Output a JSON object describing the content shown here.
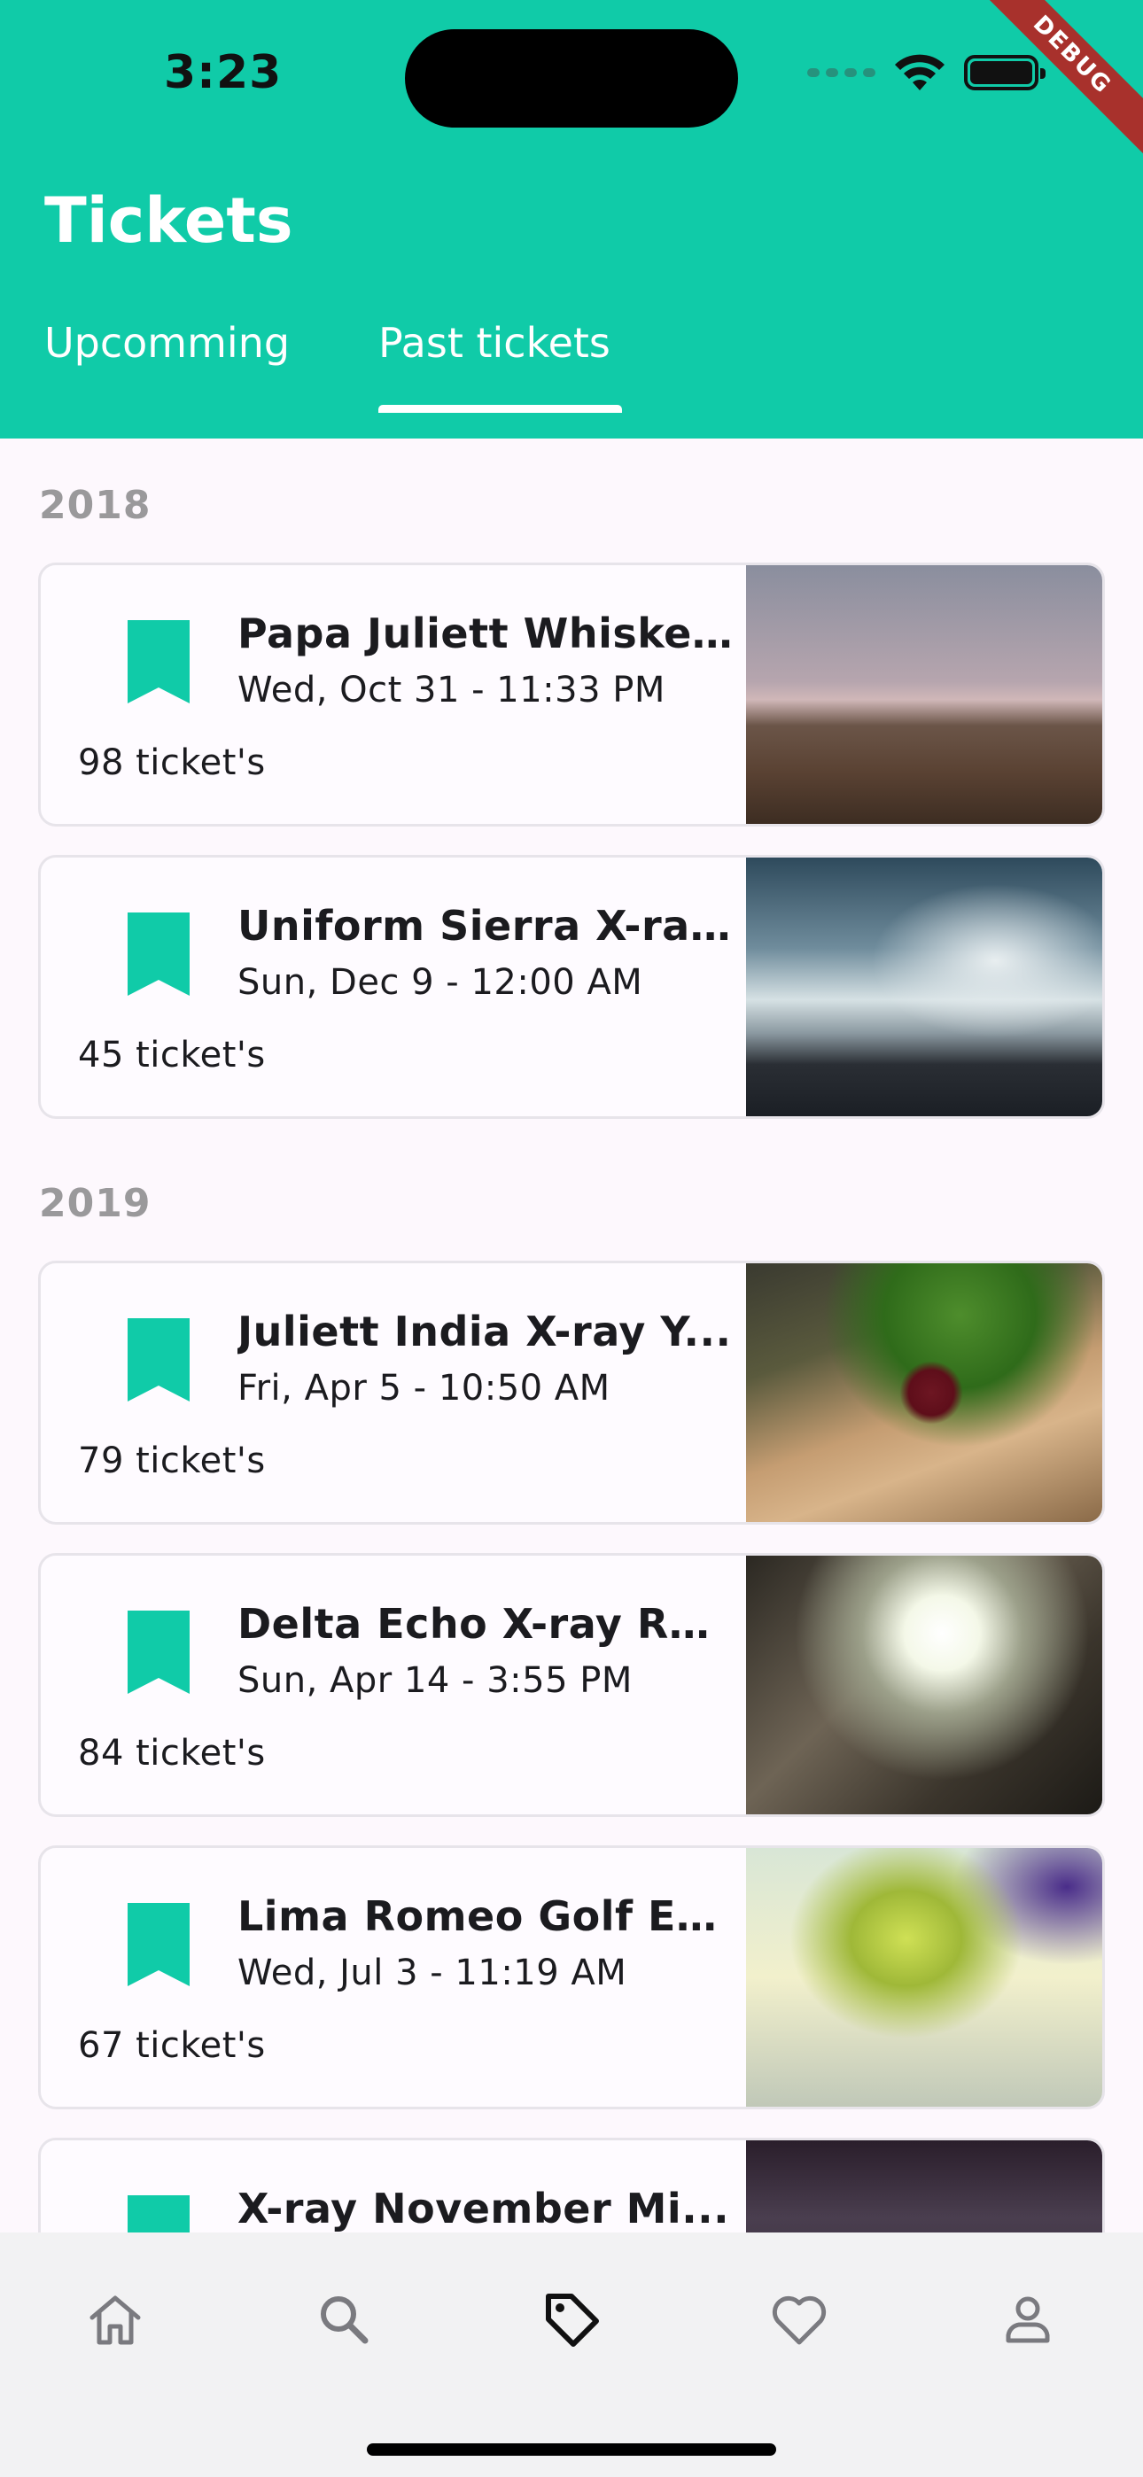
{
  "status_bar": {
    "time": "3:23"
  },
  "debug_banner": "DEBUG",
  "header": {
    "title": "Tickets",
    "tabs": [
      {
        "label": "Upcomming",
        "selected": false
      },
      {
        "label": "Past tickets",
        "selected": true
      }
    ]
  },
  "sections": [
    {
      "year": "2018",
      "tickets": [
        {
          "title": "Papa Juliett Whiske...",
          "date": "Wed, Oct 31 - 11:33 PM",
          "count": "98 ticket's",
          "image": "foggy field landscape"
        },
        {
          "title": "Uniform Sierra X-ra...",
          "date": "Sun, Dec 9 - 12:00 AM",
          "count": "45 ticket's",
          "image": "ocean waves on rocks"
        }
      ]
    },
    {
      "year": "2019",
      "tickets": [
        {
          "title": "Juliett India X-ray Y...",
          "date": "Fri, Apr 5 - 10:50 AM",
          "count": "79 ticket's",
          "image": "red onion and vegetables"
        },
        {
          "title": "Delta Echo X-ray Ro...",
          "date": "Sun, Apr 14 - 3:55 PM",
          "count": "84 ticket's",
          "image": "looking up between buildings"
        },
        {
          "title": "Lima Romeo Golf Ec...",
          "date": "Wed, Jul 3 - 11:19 AM",
          "count": "67 ticket's",
          "image": "green leaf close-up"
        },
        {
          "title": "X-ray November Mi...",
          "date": "",
          "count": "",
          "image": "dark sky"
        }
      ]
    }
  ],
  "bottom_nav": [
    {
      "icon": "home-icon",
      "active": false
    },
    {
      "icon": "search-icon",
      "active": false
    },
    {
      "icon": "tag-icon",
      "active": true
    },
    {
      "icon": "heart-icon",
      "active": false
    },
    {
      "icon": "person-icon",
      "active": false
    }
  ],
  "colors": {
    "primary": "#10cba8",
    "inactive_icon": "#7a7a7f",
    "active_icon": "#111111",
    "year_label": "#9a999b"
  }
}
